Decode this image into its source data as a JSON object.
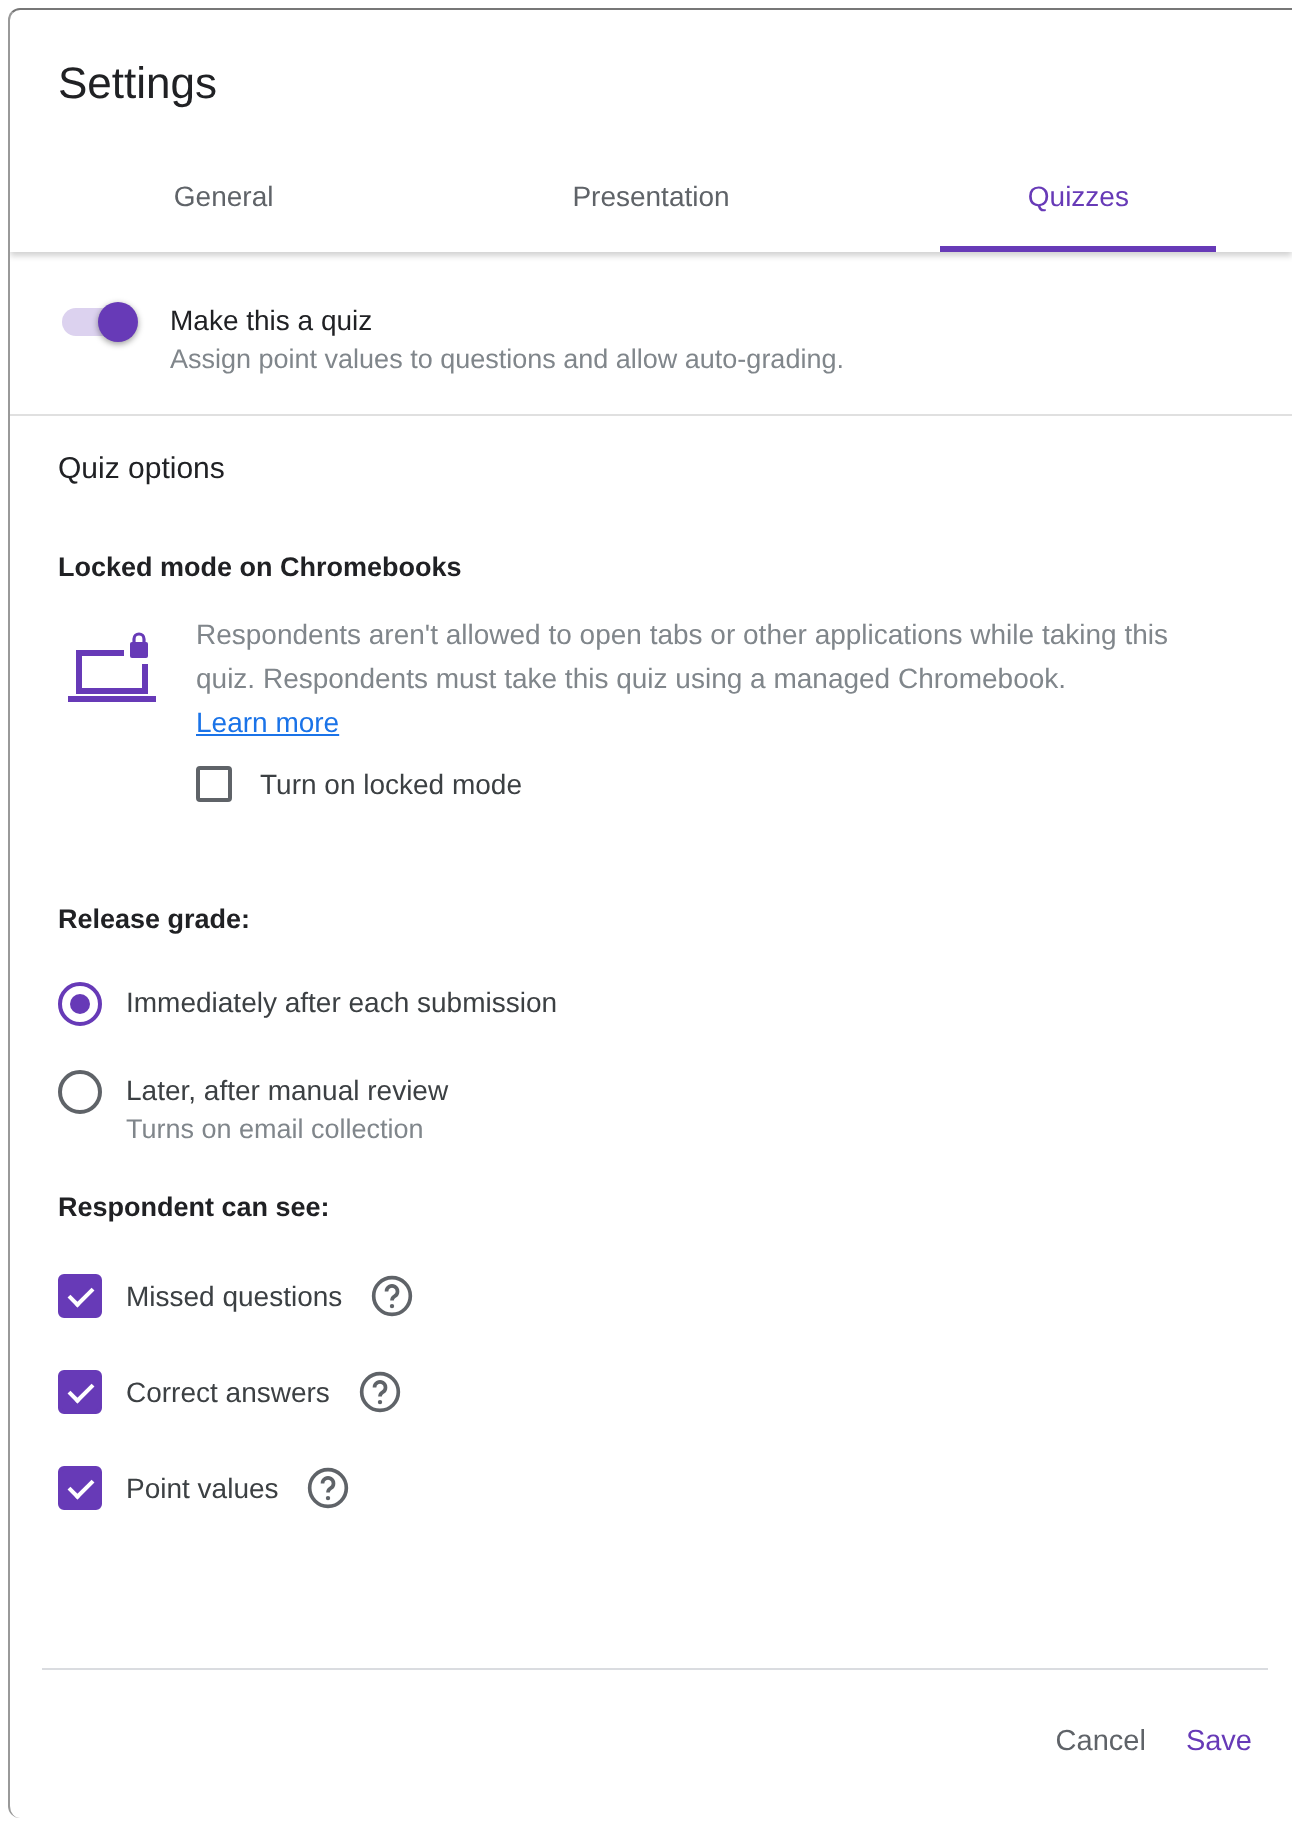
{
  "window": {
    "title": "Settings"
  },
  "tabs": [
    {
      "label": "General",
      "selected": false
    },
    {
      "label": "Presentation",
      "selected": false
    },
    {
      "label": "Quizzes",
      "selected": true
    }
  ],
  "quiz_toggle": {
    "label": "Make this a quiz",
    "description": "Assign point values to questions and allow auto-grading.",
    "on": true
  },
  "quiz_options": {
    "heading": "Quiz options",
    "locked_mode": {
      "heading": "Locked mode on Chromebooks",
      "description": "Respondents aren't allowed to open tabs or other applications while taking this quiz. Respondents must take this quiz using a managed Chromebook.",
      "link": "Learn more",
      "checkbox": {
        "label": "Turn on locked mode",
        "checked": false
      }
    },
    "release_grade": {
      "heading": "Release grade:",
      "options": [
        {
          "label": "Immediately after each submission",
          "selected": true
        },
        {
          "label": "Later, after manual review",
          "hint": "Turns on email collection",
          "selected": false
        }
      ]
    },
    "respondent_can_see": {
      "heading": "Respondent can see:",
      "options": [
        {
          "label": "Missed questions",
          "checked": true
        },
        {
          "label": "Correct answers",
          "checked": true
        },
        {
          "label": "Point values",
          "checked": true
        }
      ]
    }
  },
  "buttons": [
    {
      "label": "Cancel",
      "kind": "secondary"
    },
    {
      "label": "Save",
      "kind": "primary"
    }
  ]
}
